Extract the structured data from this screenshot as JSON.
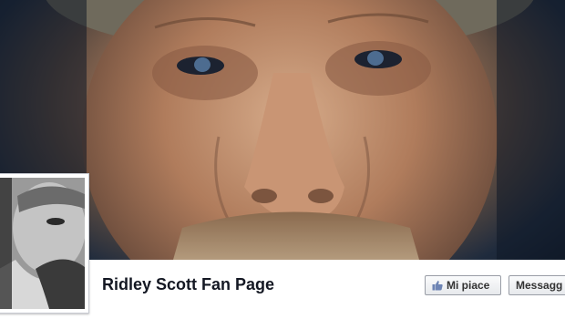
{
  "page": {
    "name": "Ridley Scott Fan Page"
  },
  "actions": {
    "like_label": "Mi piace",
    "message_label": "Messagg"
  },
  "icons": {
    "like": "thumbs-up-icon"
  },
  "colors": {
    "button_border": "#999da6",
    "name_text": "#141823",
    "cover_background": "#0f1826"
  }
}
